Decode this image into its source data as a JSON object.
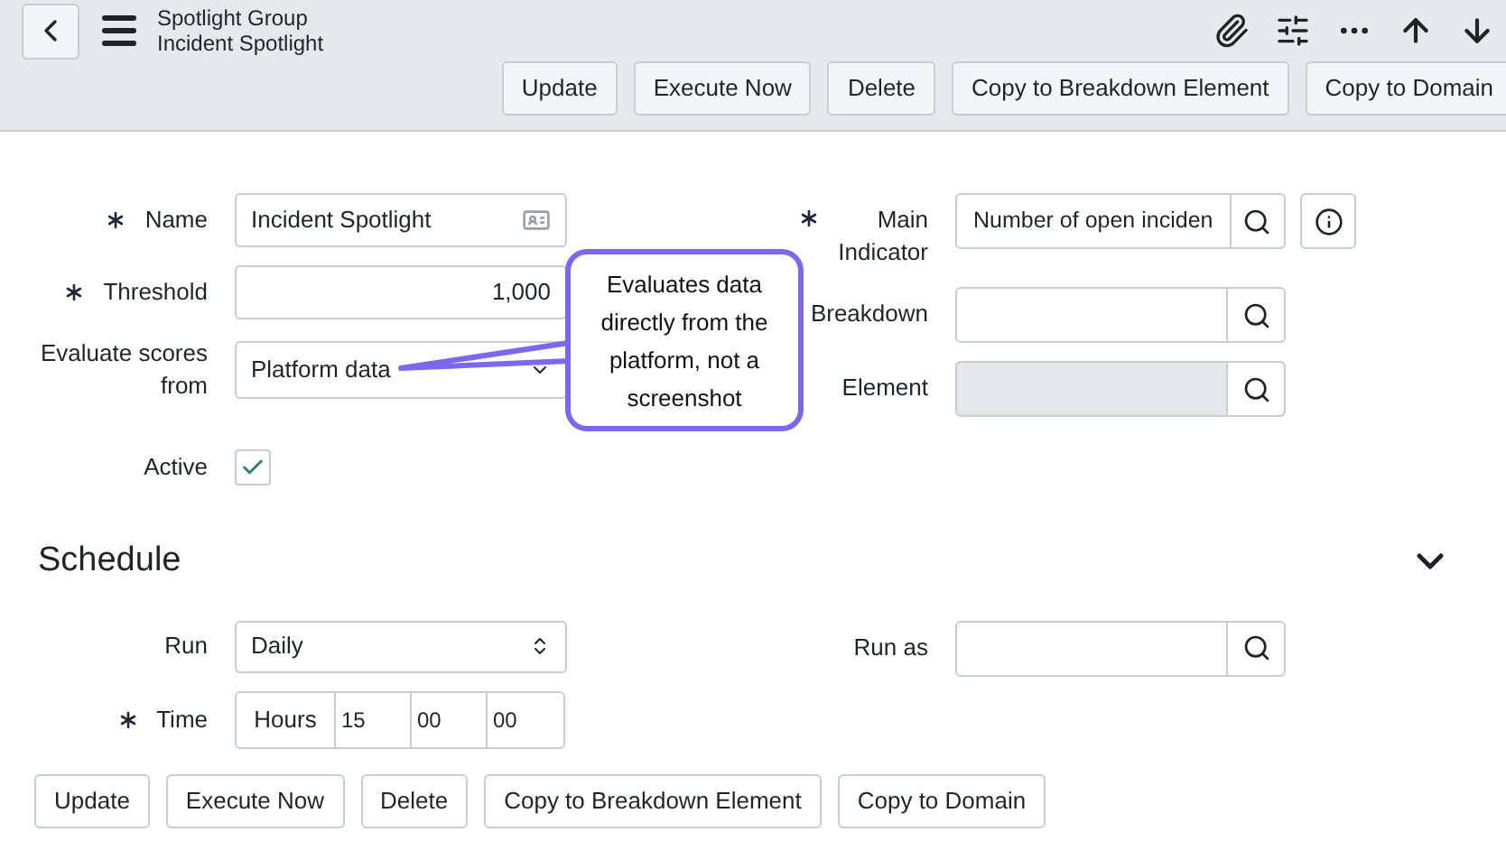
{
  "header": {
    "group": "Spotlight Group",
    "title": "Incident Spotlight",
    "buttons": [
      "Update",
      "Execute Now",
      "Delete",
      "Copy to Breakdown Element",
      "Copy to Domain"
    ]
  },
  "form": {
    "left": [
      {
        "kind": "text",
        "label": "Name",
        "required": true,
        "value": "Incident Spotlight"
      },
      {
        "kind": "number",
        "label": "Threshold",
        "required": true,
        "value": "1,000"
      },
      {
        "kind": "select",
        "label": "Evaluate scores from",
        "required": false,
        "value": "Platform data"
      },
      {
        "kind": "checkbox",
        "label": "Active",
        "required": false,
        "checked": true
      }
    ],
    "right": [
      {
        "kind": "reference",
        "label": "Main Indicator",
        "required": true,
        "value": "Number of open inciden",
        "disabled": false,
        "info": true
      },
      {
        "kind": "reference",
        "label": "Breakdown",
        "required": false,
        "disabled": false,
        "info": false
      },
      {
        "kind": "reference",
        "label": "Element",
        "required": false,
        "disabled": true,
        "info": false
      }
    ]
  },
  "callout": {
    "text": "Evaluates data directly from the platform, not a screenshot"
  },
  "schedule": {
    "title": "Schedule",
    "expanded": true,
    "run": {
      "label": "Run",
      "value": "Daily"
    },
    "run_as": {
      "label": "Run as"
    },
    "time": {
      "label": "Time",
      "required": true,
      "unit": "Hours",
      "values": [
        "15",
        "00",
        "00"
      ]
    }
  },
  "footer_buttons": [
    "Update",
    "Execute Now",
    "Delete",
    "Copy to Breakdown Element",
    "Copy to Domain"
  ]
}
